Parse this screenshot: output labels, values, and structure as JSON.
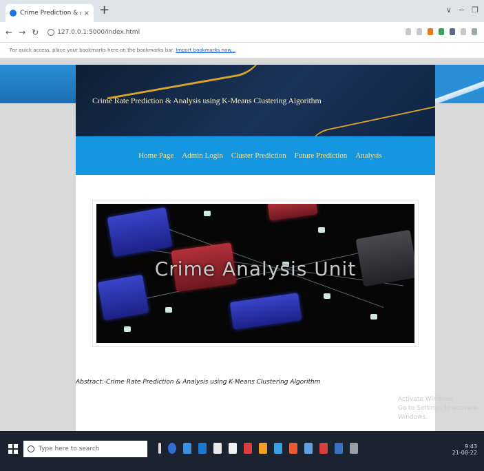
{
  "browser": {
    "tab_title": "Crime Prediction & Analysis",
    "tab_close": "×",
    "new_tab": "+",
    "window_controls": [
      "∨",
      "−",
      "❐"
    ],
    "url": "127.0.0.1:5000/index.html",
    "bookmark_hint": "For quick access, place your bookmarks here on the bookmarks bar.",
    "bookmark_link": "Import bookmarks now..."
  },
  "site": {
    "title": "Crime Rate Prediction & Analysis using K-Means Clustering Algorithm",
    "nav": [
      "Home Page",
      "Admin Login",
      "Cluster Prediction",
      "Future Prediction",
      "Analysis"
    ],
    "hero_text": "Crime Analysis Unit",
    "abstract": "Abstract:-Crime Rate Prediction & Analysis using K-Means Clustering Algorithm"
  },
  "watermark": {
    "line1": "Activate Windows",
    "line2": "Go to Settings to activate Windows."
  },
  "taskbar": {
    "search_placeholder": "Type here to search",
    "time": "9:43",
    "date": "21-08-22"
  },
  "colors": {
    "nav_bg": "#1497e0",
    "nav_text": "#f6e79a",
    "banner_bg": "#1a3358",
    "accent_gold": "#d8a42a"
  }
}
